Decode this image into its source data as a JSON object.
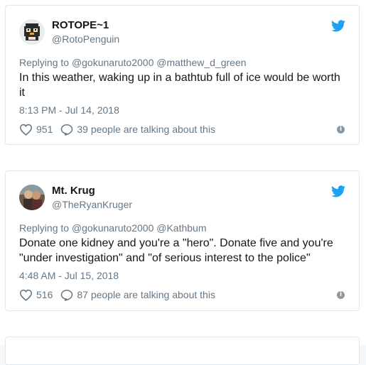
{
  "tweets": [
    {
      "name": "ROTOPE~1",
      "handle": "@RotoPenguin",
      "reply_prefix": "Replying to",
      "reply_to": "@gokunaruto2000 @matthew_d_green",
      "text_line1": "In this weather, waking up in a bathtub full of ice would be worth",
      "text_line2": "it",
      "time": "8:13 PM - Jul 14, 2018",
      "likes": "951",
      "talking": "39 people are talking about this",
      "avatar_icon": "penguin-pixel-avatar"
    },
    {
      "name": "Mt. Krug",
      "handle": "@TheRyanKruger",
      "reply_prefix": "Replying to",
      "reply_to": "@gokunaruto2000 @Kathbum",
      "text_line1": "Donate one kidney and you're a \"hero\". Donate five and you're",
      "text_line2": "\"under investigation\" and \"of serious interest to the police\"",
      "time": "4:48 AM - Jul 15, 2018",
      "likes": "516",
      "talking": "87 people are talking about this",
      "avatar_icon": "photo-avatar"
    }
  ],
  "colors": {
    "text": "#14171a",
    "secondary": "#657786",
    "twitter_blue": "#1da1f2",
    "border": "#e1e8ed"
  },
  "icons": [
    "twitter-bird-icon",
    "heart-icon",
    "reply-bubble-icon",
    "info-icon"
  ]
}
